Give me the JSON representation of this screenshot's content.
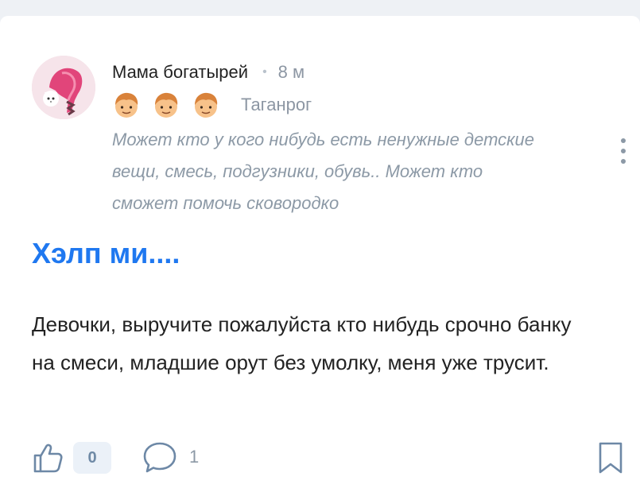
{
  "post": {
    "author_name": "Мама богатырей",
    "time_separator": "•",
    "time_ago": "8 м",
    "badges": [
      "boy-emoji-icon",
      "boy-emoji-icon",
      "boy-emoji-icon"
    ],
    "city": "Таганрог",
    "status_text": "Может кто у кого нибудь есть ненужные детские вещи, смесь, подгузники, обувь.. Может кто сможет помочь сковородко",
    "title": "Хэлп ми....",
    "body": "Девочки, выручите пожалуйста кто нибудь срочно банку на смеси, младшие орут без умолку, меня уже трусит."
  },
  "actions": {
    "like_icon": "thumbs-up-icon",
    "likes": "0",
    "comment_icon": "comment-bubble-icon",
    "comments": "1",
    "bookmark_icon": "bookmark-icon",
    "more_icon": "vertical-dots-icon"
  },
  "colors": {
    "title_accent": "#1f78f0",
    "muted_text": "#8c99a6",
    "background": "#eef1f5"
  }
}
